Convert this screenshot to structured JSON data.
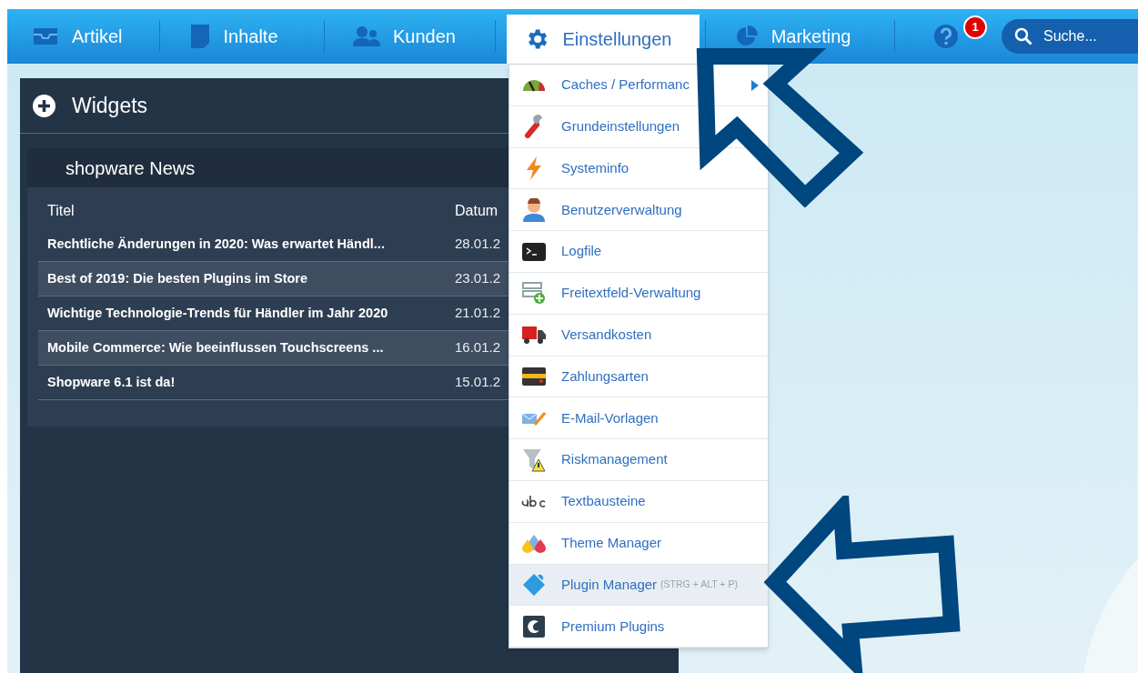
{
  "nav": {
    "items": [
      {
        "label": "Artikel",
        "selected": false
      },
      {
        "label": "Inhalte",
        "selected": false
      },
      {
        "label": "Kunden",
        "selected": false
      },
      {
        "label": "Einstellungen",
        "selected": true
      },
      {
        "label": "Marketing",
        "selected": false
      }
    ],
    "help_badge": "1",
    "search": {
      "placeholder": "Suche..."
    }
  },
  "widgets_panel": {
    "title": "Widgets",
    "news_widget": {
      "title": "shopware News",
      "columns": [
        "Titel",
        "Datum"
      ],
      "rows": [
        {
          "title": "Rechtliche Änderungen in 2020: Was erwartet Händl...",
          "date": "28.01.2"
        },
        {
          "title": "Best of 2019: Die besten Plugins im Store",
          "date": "23.01.2"
        },
        {
          "title": "Wichtige Technologie-Trends für Händler im Jahr 2020",
          "date": "21.01.2"
        },
        {
          "title": "Mobile Commerce: Wie beeinflussen Touchscreens ...",
          "date": "16.01.2"
        },
        {
          "title": "Shopware 6.1 ist da!",
          "date": "15.01.2"
        }
      ]
    }
  },
  "settings_menu": {
    "items": [
      {
        "label": "Caches / Performanc",
        "submenu": true,
        "selected": false
      },
      {
        "label": "Grundeinstellungen",
        "submenu": false,
        "selected": false
      },
      {
        "label": "Systeminfo",
        "submenu": false,
        "selected": false
      },
      {
        "label": "Benutzerverwaltung",
        "submenu": false,
        "selected": false
      },
      {
        "label": "Logfile",
        "submenu": false,
        "selected": false
      },
      {
        "label": "Freitextfeld-Verwaltung",
        "submenu": false,
        "selected": false
      },
      {
        "label": "Versandkosten",
        "submenu": false,
        "selected": false
      },
      {
        "label": "Zahlungsarten",
        "submenu": false,
        "selected": false
      },
      {
        "label": "E-Mail-Vorlagen",
        "submenu": false,
        "selected": false
      },
      {
        "label": "Riskmanagement",
        "submenu": false,
        "selected": false
      },
      {
        "label": "Textbausteine",
        "submenu": false,
        "selected": false
      },
      {
        "label": "Theme Manager",
        "submenu": false,
        "selected": false
      },
      {
        "label": "Plugin Manager",
        "shortcut": "(STRG + ALT + P)",
        "submenu": false,
        "selected": true
      },
      {
        "label": "Premium Plugins",
        "submenu": false,
        "selected": false
      }
    ]
  }
}
